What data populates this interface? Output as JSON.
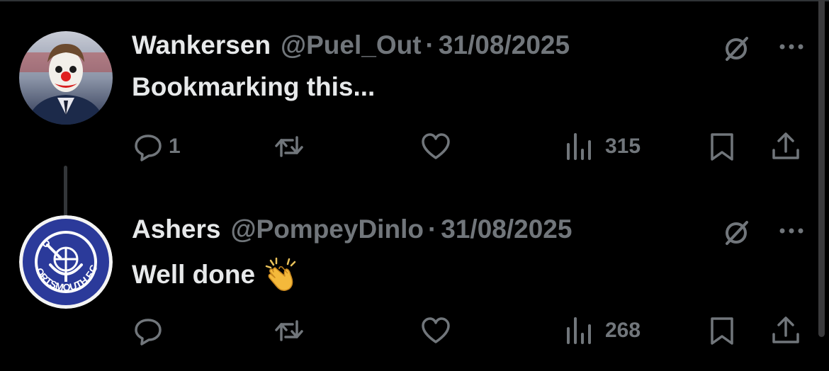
{
  "tweets": [
    {
      "name": "Wankersen",
      "handle": "@Puel_Out",
      "separator": "·",
      "date": "31/08/2025",
      "text": "Bookmarking this...",
      "reply_count": "1",
      "retweet_count": "",
      "like_count": "",
      "view_count": "315"
    },
    {
      "name": "Ashers",
      "handle": "@PompeyDinlo",
      "separator": "·",
      "date": "31/08/2025",
      "text": "Well done",
      "reply_count": "",
      "retweet_count": "",
      "like_count": "",
      "view_count": "268",
      "avatar_text": "PORTSMOUTH F.C."
    }
  ],
  "colors": {
    "background": "#000000",
    "text_primary": "#e7e9ea",
    "text_secondary": "#71767b",
    "thread_line": "#333639",
    "portsmouth_blue": "#2b3a9a"
  },
  "icons": [
    "reply-icon",
    "retweet-icon",
    "like-icon",
    "views-icon",
    "bookmark-icon",
    "share-icon",
    "grok-icon",
    "more-icon",
    "clap-emoji"
  ]
}
